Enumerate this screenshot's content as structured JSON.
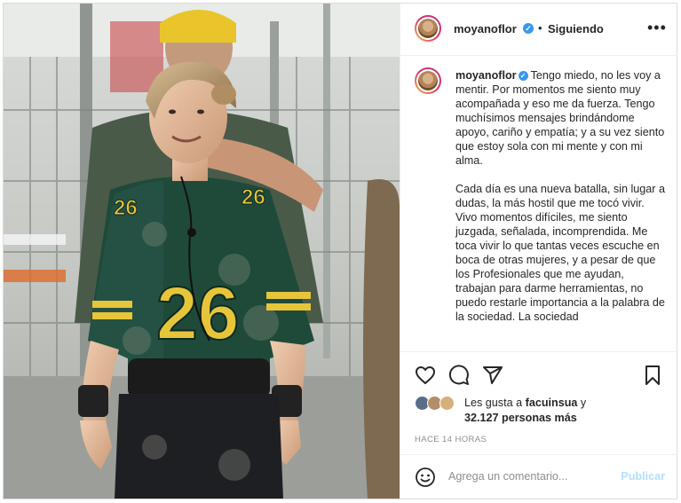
{
  "post": {
    "username": "moyanoflor",
    "verified_mark": "✓",
    "separator": "•",
    "follow_status": "Siguiendo",
    "more_label": "•••",
    "caption_paragraphs": [
      "Tengo miedo, no les voy a mentir. Por momentos me siento muy acompañada y eso me da fuerza. Tengo muchísimos mensajes brindándome apoyo, cariño y empatía; y a su vez siento que estoy sola con mi mente y con mi alma.",
      "Cada día es una nueva batalla, sin lugar a dudas, la más hostil que me tocó vivir. Vivo momentos difíciles, me siento juzgada, señalada, incomprendida. Me toca vivir lo que tantas veces escuche en boca de otras mujeres, y a pesar de que los Profesionales que me ayudan, trabajan para darme herramientas, no puedo restarle importancia a la palabra de la sociedad. La sociedad"
    ],
    "likes_prefix": "Les gusta a",
    "likes_user": "facuinsua",
    "likes_conj": "y",
    "likes_others": "32.127 personas más",
    "time_ago": "HACE 14 HORAS",
    "comment_placeholder": "Agrega un comentario...",
    "publish_label": "Publicar"
  },
  "photo": {
    "jersey_number": "26",
    "jersey_color": "#1f4a3a",
    "number_color": "#e7c53a"
  },
  "colors": {
    "verified": "#3897f0",
    "text": "#262626",
    "muted": "#8e8e8e",
    "publish_disabled": "#b2dffc"
  },
  "icons": [
    "heart-icon",
    "comment-icon",
    "share-icon",
    "bookmark-icon",
    "emoji-icon",
    "more-icon",
    "verified-icon"
  ]
}
